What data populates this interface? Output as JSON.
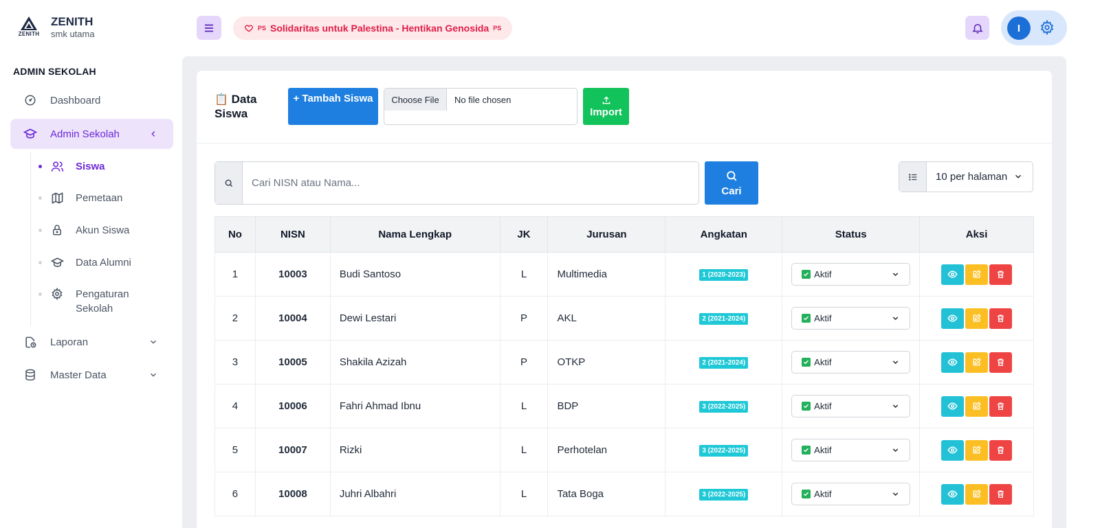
{
  "brand": {
    "name": "ZENITH",
    "logo_text": "ZENITH",
    "subtitle": "smk utama"
  },
  "sidebar": {
    "section_title": "ADMIN SEKOLAH",
    "items": [
      {
        "label": "Dashboard",
        "icon": "gauge-icon"
      },
      {
        "label": "Admin Sekolah",
        "icon": "graduation-cap-icon",
        "active": true,
        "expanded": true
      },
      {
        "label": "Laporan",
        "icon": "report-clock-icon"
      },
      {
        "label": "Master Data",
        "icon": "database-icon"
      }
    ],
    "submenu": [
      {
        "label": "Siswa",
        "icon": "users-icon",
        "active": true
      },
      {
        "label": "Pemetaan",
        "icon": "map-icon"
      },
      {
        "label": "Akun Siswa",
        "icon": "lock-icon"
      },
      {
        "label": "Data Alumni",
        "icon": "graduation-cap-icon"
      },
      {
        "label": "Pengaturan Sekolah",
        "icon": "gear-icon"
      }
    ]
  },
  "header": {
    "banner_text": "Solidaritas untuk Palestina - Hentikan Genosida",
    "banner_tag": "PS",
    "avatar_initial": "I"
  },
  "page": {
    "title_emoji": "📋",
    "title": "Data Siswa",
    "add_button": "+ Tambah Siswa",
    "file_button": "Choose File",
    "file_label": "No file chosen",
    "import_button": "Import",
    "search_placeholder": "Cari NISN atau Nama...",
    "search_button": "Cari",
    "per_page": "10 per halaman"
  },
  "table": {
    "headers": [
      "No",
      "NISN",
      "Nama Lengkap",
      "JK",
      "Jurusan",
      "Angkatan",
      "Status",
      "Aksi"
    ],
    "rows": [
      {
        "no": "1",
        "nisn": "10003",
        "nama": "Budi Santoso",
        "jk": "L",
        "jurusan": "Multimedia",
        "angkatan": "1 (2020-2023)",
        "status": "Aktif"
      },
      {
        "no": "2",
        "nisn": "10004",
        "nama": "Dewi Lestari",
        "jk": "P",
        "jurusan": "AKL",
        "angkatan": "2 (2021-2024)",
        "status": "Aktif"
      },
      {
        "no": "3",
        "nisn": "10005",
        "nama": "Shakila Azizah",
        "jk": "P",
        "jurusan": "OTKP",
        "angkatan": "2 (2021-2024)",
        "status": "Aktif"
      },
      {
        "no": "4",
        "nisn": "10006",
        "nama": "Fahri Ahmad Ibnu",
        "jk": "L",
        "jurusan": "BDP",
        "angkatan": "3 (2022-2025)",
        "status": "Aktif"
      },
      {
        "no": "5",
        "nisn": "10007",
        "nama": "Rizki",
        "jk": "L",
        "jurusan": "Perhotelan",
        "angkatan": "3 (2022-2025)",
        "status": "Aktif"
      },
      {
        "no": "6",
        "nisn": "10008",
        "nama": "Juhri Albahri",
        "jk": "L",
        "jurusan": "Tata Boga",
        "angkatan": "3 (2022-2025)",
        "status": "Aktif"
      }
    ]
  },
  "colors": {
    "accent_purple": "#6d28d9",
    "primary_blue": "#1e7fe0",
    "success_green": "#12c25a",
    "banner_red": "#e11d48",
    "badge_cyan": "#1ec8d6",
    "edit_yellow": "#fbbf24",
    "delete_red": "#ef4444"
  }
}
